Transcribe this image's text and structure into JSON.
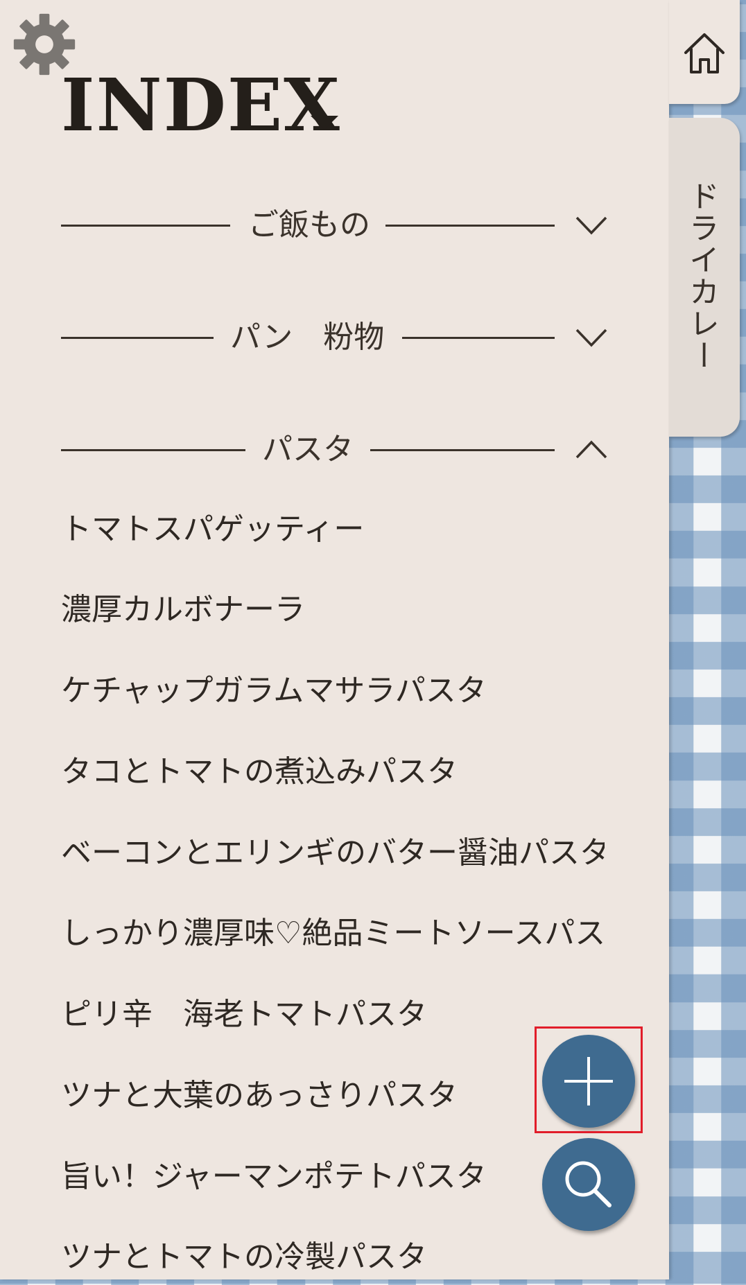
{
  "index": {
    "title": "INDEX"
  },
  "categories": [
    {
      "label": "ご飯もの",
      "expanded": false
    },
    {
      "label": "パン　粉物",
      "expanded": false
    },
    {
      "label": "パスタ",
      "expanded": true
    }
  ],
  "pasta_items": [
    "トマトスパゲッティー",
    "濃厚カルボナーラ",
    "ケチャップガラムマサラパスタ",
    "タコとトマトの煮込みパスタ",
    "ベーコンとエリンギのバター醤油パスタ",
    "しっかり濃厚味♡絶品ミートソースパスタ",
    "ピリ辛　海老トマトパスタ",
    "ツナと大葉のあっさりパスタ",
    "旨い！ジャーマンポテトパスタ",
    "ツナとトマトの冷製パスタ"
  ],
  "tabs": {
    "home_icon": "home-icon",
    "current_recipe": "ドライカレー"
  },
  "icons": {
    "settings": "gear-icon",
    "add": "plus-icon",
    "search": "search-icon"
  },
  "colors": {
    "panel": "#eee6e0",
    "fab": "#3f6b90",
    "highlight": "#e11d2a",
    "gingham": "#6890ba"
  }
}
